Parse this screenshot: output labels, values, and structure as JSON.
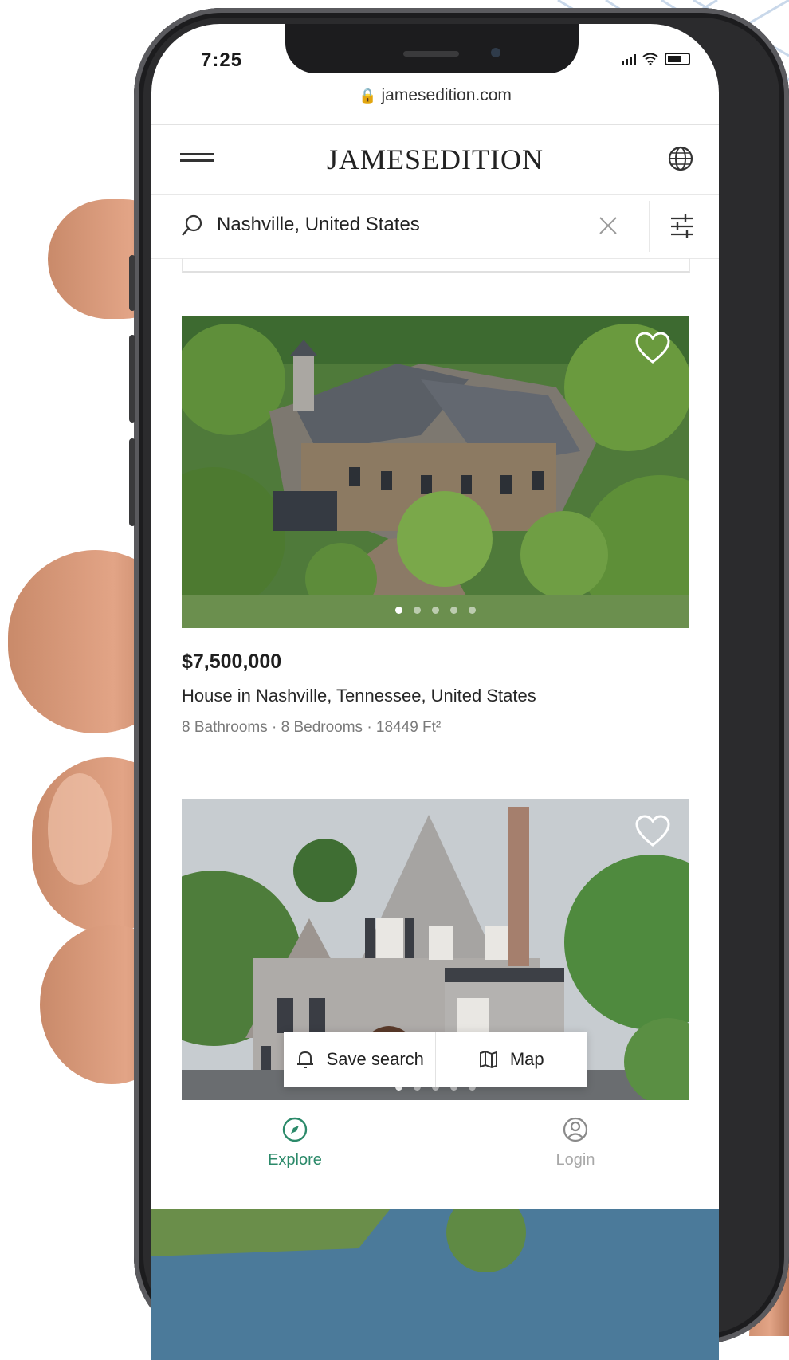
{
  "status_bar": {
    "time": "7:25"
  },
  "browser": {
    "url": "jamesedition.com"
  },
  "header": {
    "brand": "JAMESEDITION"
  },
  "search": {
    "query": "Nashville, United States"
  },
  "listing": {
    "price": "$7,500,000",
    "title": "House in Nashville, Tennessee, United States",
    "specs": "8 Bathrooms · 8 Bedrooms · 18449 Ft²",
    "photo_count": 5,
    "active_photo": 1
  },
  "listing_2": {
    "photo_count": 5
  },
  "actions": {
    "save_search": "Save search",
    "map": "Map"
  },
  "tabs": [
    {
      "label": "Explore",
      "active": true
    },
    {
      "label": "Login",
      "active": false
    }
  ],
  "colors": {
    "accent": "#2c8a6a",
    "inactive": "#a8a8a8"
  }
}
